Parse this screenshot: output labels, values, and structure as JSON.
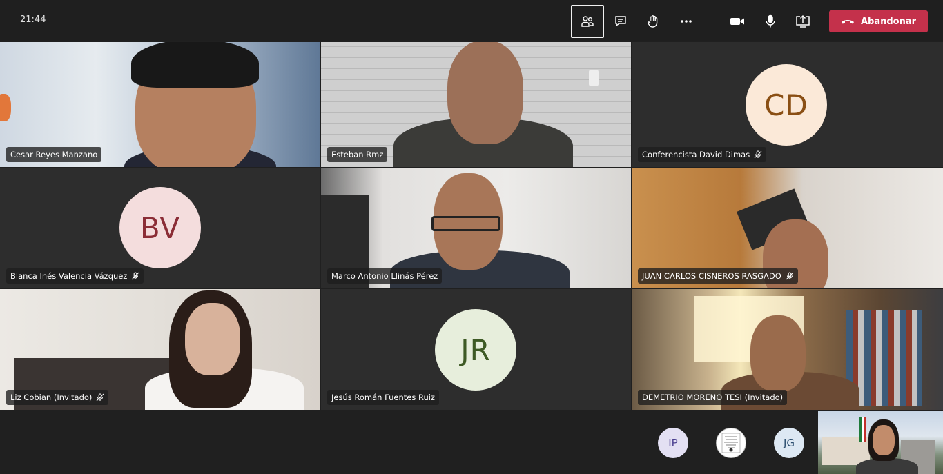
{
  "toolbar": {
    "clock": "21:44",
    "leave_label": "Abandonar",
    "icons": [
      "participants-icon",
      "chat-icon",
      "raise-hand-icon",
      "more-options-icon",
      "camera-icon",
      "microphone-icon",
      "share-screen-icon",
      "hangup-icon"
    ],
    "leave_color": "#c4314b"
  },
  "participants": [
    {
      "name": "Cesar Reyes Manzano",
      "muted": false
    },
    {
      "name": "Esteban Rmz",
      "muted": false
    },
    {
      "name": "Conferencista David Dimas",
      "initials": "CD",
      "muted": true,
      "avatar_bg": "#fbe9d8",
      "avatar_fg": "#8a4f14"
    },
    {
      "name": "Blanca Inés Valencia Vázquez",
      "initials": "BV",
      "muted": true,
      "avatar_bg": "#f4dddd",
      "avatar_fg": "#8b2d36"
    },
    {
      "name": "Marco Antonio Llinás Pérez",
      "muted": false
    },
    {
      "name": "JUAN CARLOS CISNEROS RASGADO",
      "muted": true
    },
    {
      "name": "Liz Cobian (Invitado)",
      "muted": true
    },
    {
      "name": "Jesús Román Fuentes Ruiz",
      "initials": "JR",
      "muted": false,
      "avatar_bg": "#e7eedc",
      "avatar_fg": "#3e5a25"
    },
    {
      "name": "DEMETRIO MORENO TESI (Invitado)",
      "muted": false
    }
  ],
  "overflow": [
    {
      "initials": "IP",
      "bg": "#e3e0f3",
      "fg": "#4a3f8f"
    },
    {
      "initials": "",
      "bg": "#ffffff",
      "fg": "#000000"
    },
    {
      "initials": "JG",
      "bg": "#dde8f3",
      "fg": "#2b4d6e"
    }
  ]
}
